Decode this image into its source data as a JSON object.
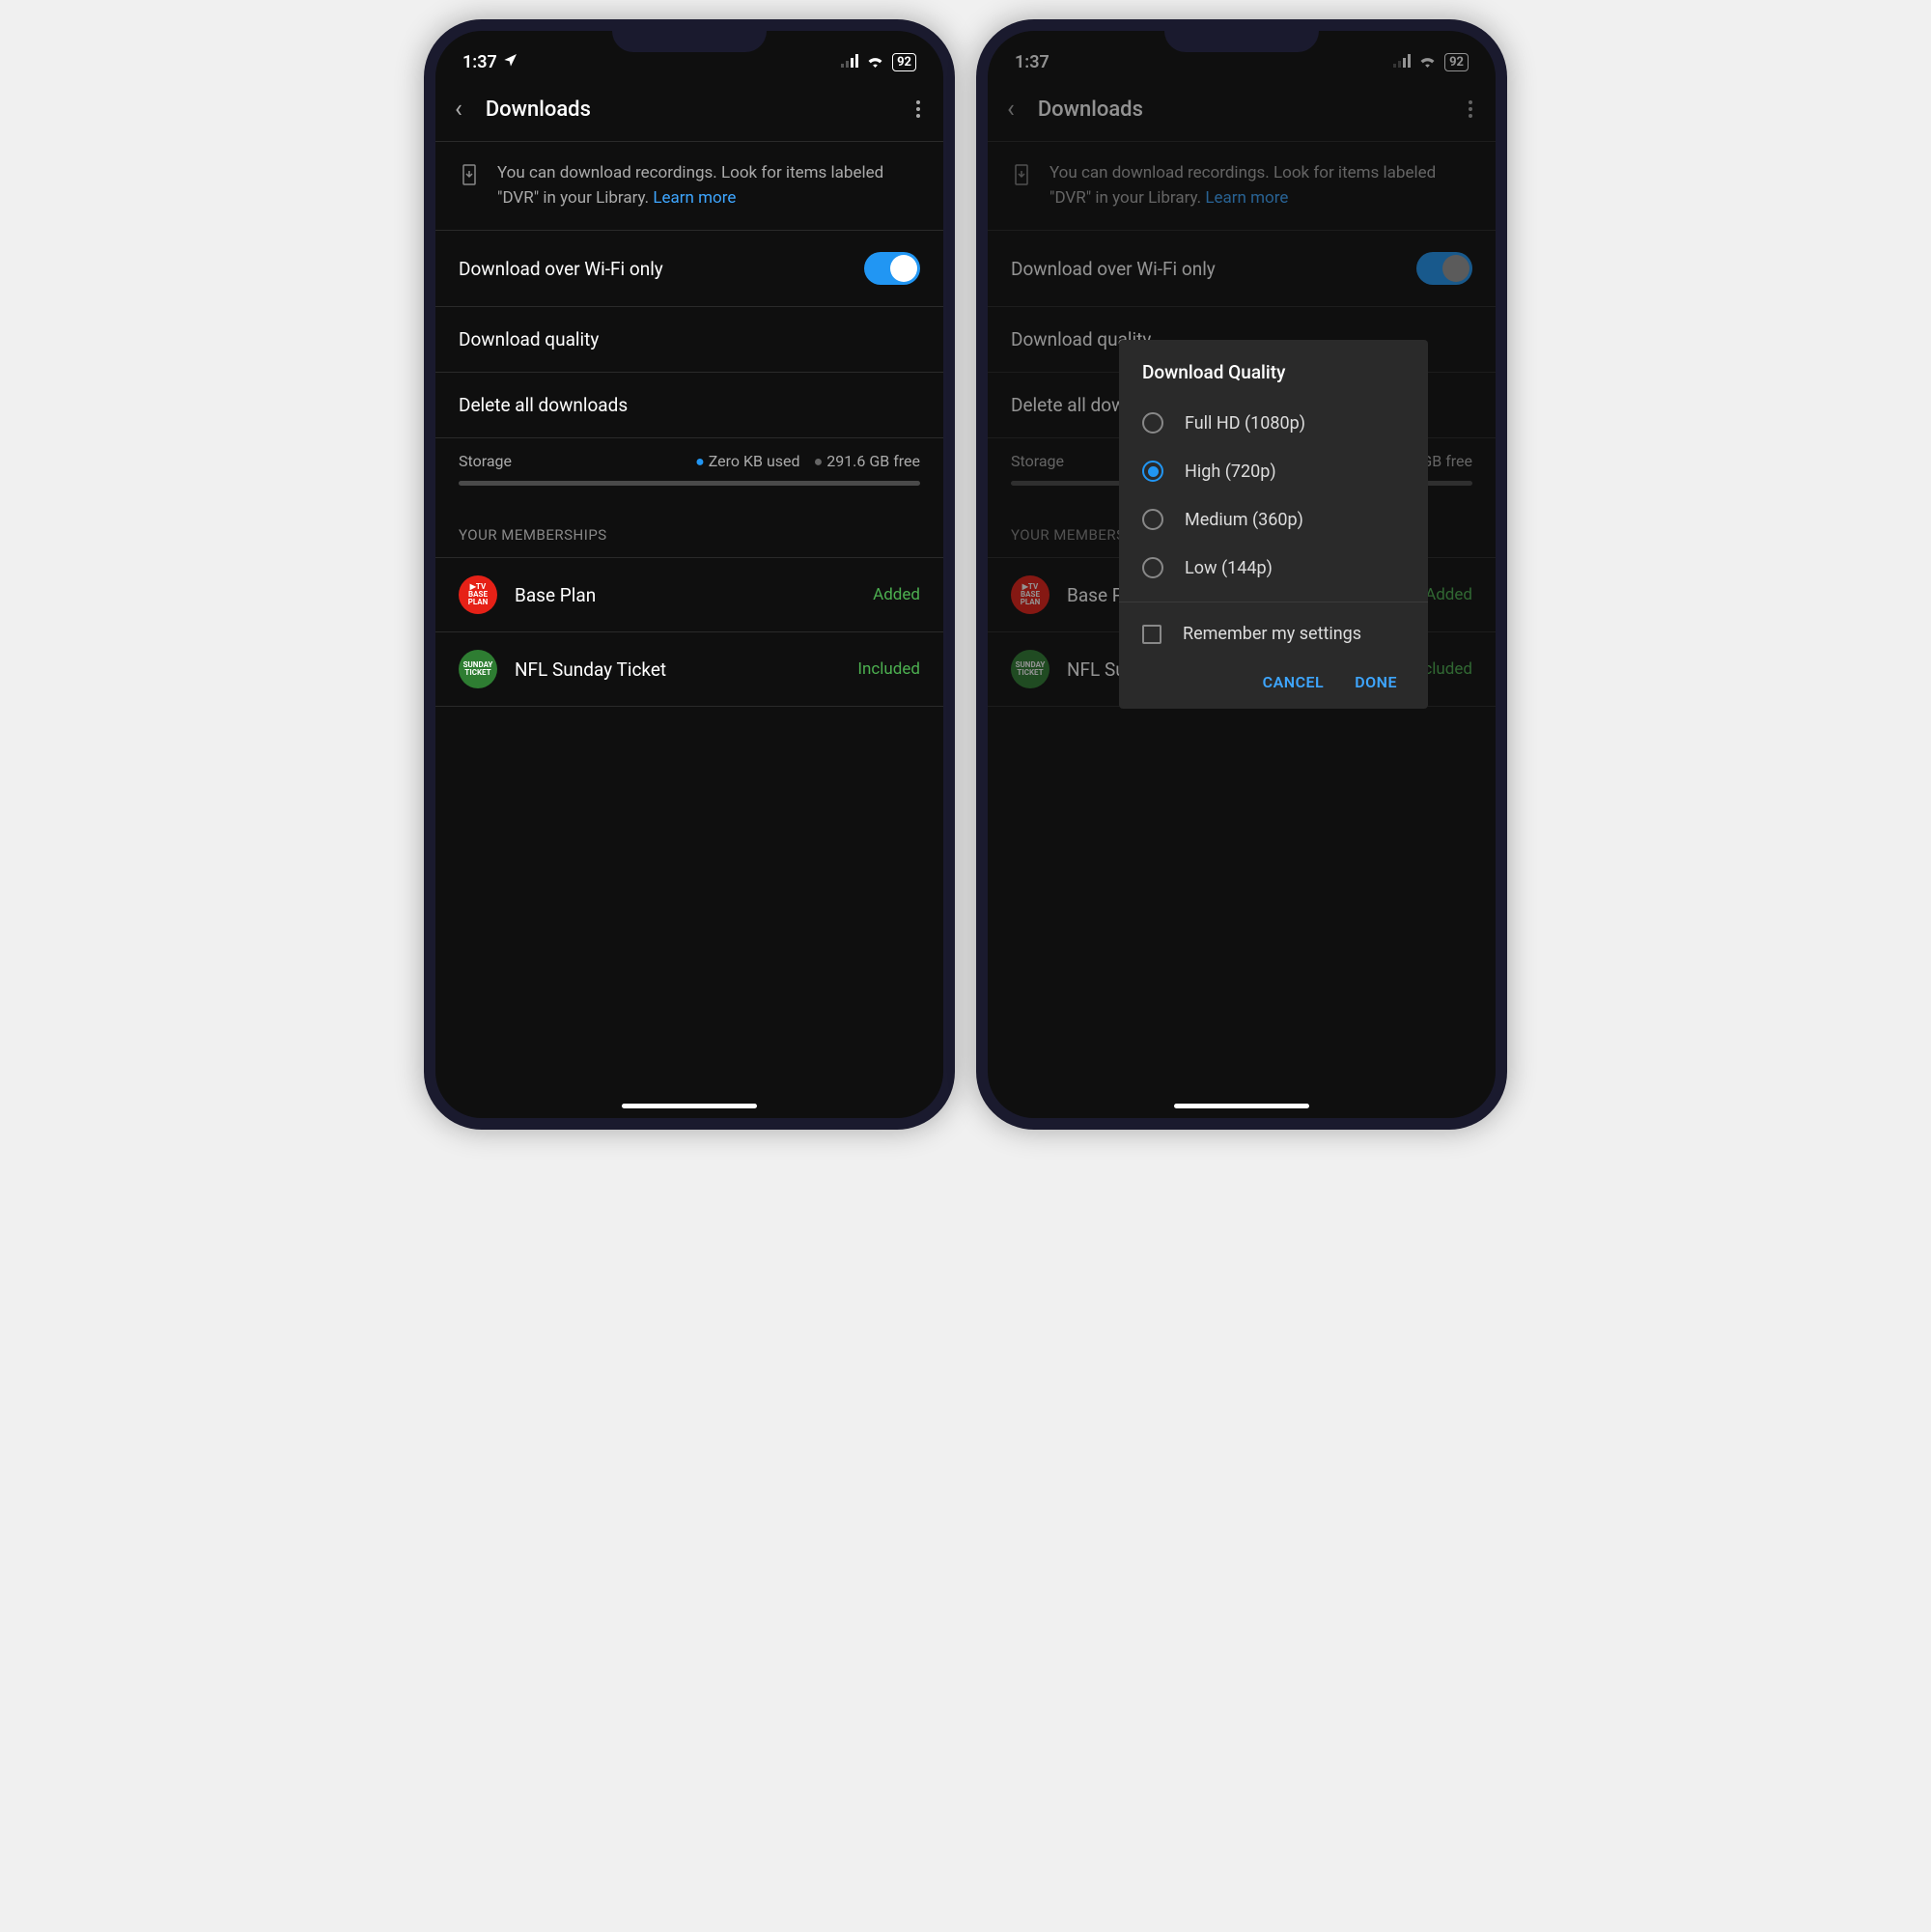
{
  "status": {
    "time": "1:37",
    "battery": "92"
  },
  "nav": {
    "title": "Downloads"
  },
  "banner": {
    "text": "You can download recordings. Look for items labeled \"DVR\" in your Library. ",
    "link": "Learn more"
  },
  "settings": {
    "wifi_only": "Download over Wi-Fi only",
    "quality": "Download quality",
    "delete": "Delete all downloads"
  },
  "storage": {
    "label": "Storage",
    "used": "Zero KB used",
    "free": "291.6 GB free"
  },
  "memberships_header": "YOUR MEMBERSHIPS",
  "memberships": [
    {
      "name": "Base Plan",
      "status": "Added",
      "icon_bg": "#e62117",
      "icon_label": "TV\nBASE\nPLAN"
    },
    {
      "name": "NFL Sunday Ticket",
      "status": "Included",
      "icon_bg": "#2e7d32",
      "icon_label": "SUNDAY\nTICKET"
    }
  ],
  "dialog": {
    "title": "Download Quality",
    "options": [
      {
        "label": "Full HD (1080p)",
        "selected": false
      },
      {
        "label": "High (720p)",
        "selected": true
      },
      {
        "label": "Medium (360p)",
        "selected": false
      },
      {
        "label": "Low (144p)",
        "selected": false
      }
    ],
    "remember": "Remember my settings",
    "cancel": "CANCEL",
    "done": "DONE"
  }
}
